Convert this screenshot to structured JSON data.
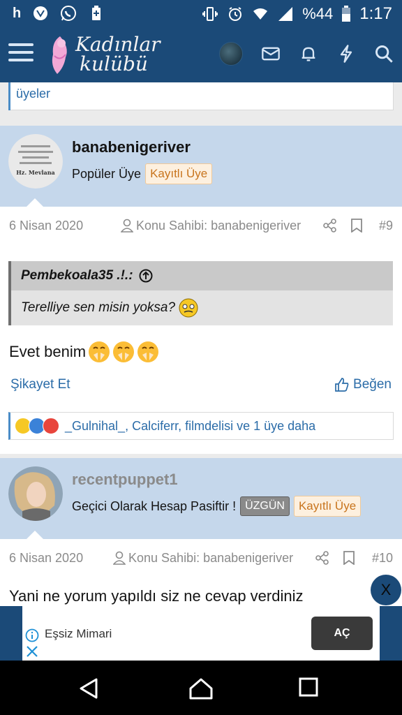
{
  "status_bar": {
    "left_h": "h",
    "battery": "%44",
    "time": "1:17"
  },
  "nav": {
    "logo_line1": "Kadınlar",
    "logo_line2": "kulübü"
  },
  "previous_post": {
    "reaction_text": "üyeler"
  },
  "posts": [
    {
      "username": "banabenigeriver",
      "title": "Popüler Üye",
      "badges": [
        "Kayıtlı Üye"
      ],
      "avatar_text": "Hz. Mevlana",
      "date": "6 Nisan 2020",
      "owner_label": "Konu Sahibi: banabenigeriver",
      "number": "#9",
      "quote": {
        "author": "Pembekoala35 .!.:",
        "text": "Terelliye sen misin yoksa?"
      },
      "body": "Evet benim",
      "report": "Şikayet Et",
      "like": "Beğen",
      "reactions": "_Gulnihal_, Calciferr, filmdelisi ve 1 üye daha"
    },
    {
      "username": "recentpuppet1",
      "title": "Geçici Olarak Hesap Pasiftir !",
      "badges": [
        "ÜZGÜN",
        "Kayıtlı Üye"
      ],
      "date": "6 Nisan 2020",
      "owner_label": "Konu Sahibi: banabenigeriver",
      "number": "#10",
      "body": "Yani ne yorum yapıldı siz ne cevap verdiniz"
    }
  ],
  "floating_close": "X",
  "ad": {
    "title": "Eşsiz Mimari",
    "cta": "AÇ"
  },
  "colors": {
    "header_blue": "#1b4a78",
    "post_header": "#c5d7eb",
    "link_blue": "#2b6ca8",
    "badge_orange": "#c8741d"
  }
}
